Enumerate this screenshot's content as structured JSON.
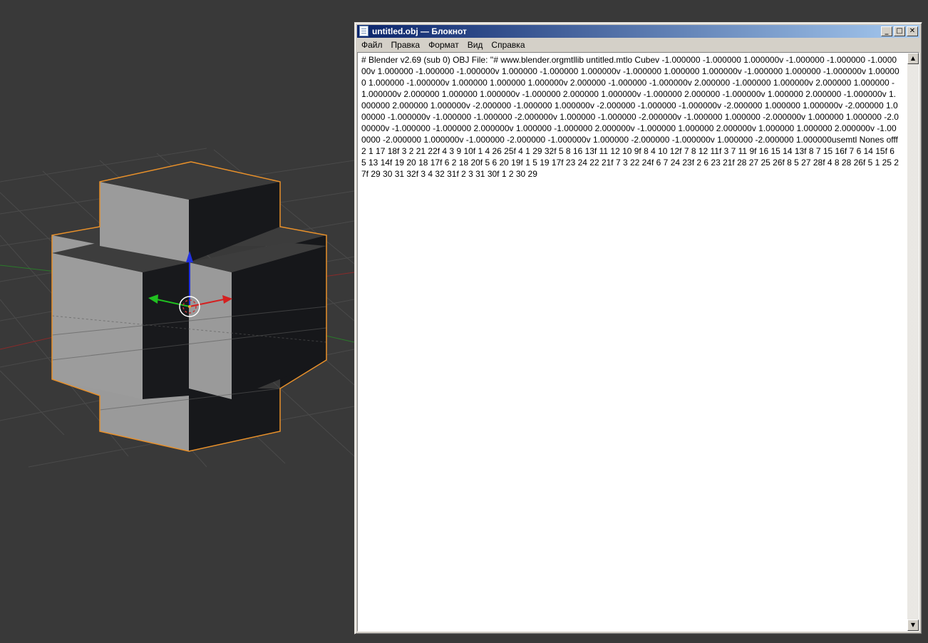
{
  "window": {
    "title": "untitled.obj — Блокнот",
    "buttons": {
      "minimize": "_",
      "maximize": "□",
      "close": "✕"
    }
  },
  "menu": [
    "Файл",
    "Правка",
    "Формат",
    "Вид",
    "Справка"
  ],
  "editor": {
    "content": "# Blender v2.69 (sub 0) OBJ File: ''# www.blender.orgmtllib untitled.mtlo Cubev -1.000000 -1.000000 1.000000v -1.000000 -1.000000 -1.000000v 1.000000 -1.000000 -1.000000v 1.000000 -1.000000 1.000000v -1.000000 1.000000 1.000000v -1.000000 1.000000 -1.000000v 1.000000 1.000000 -1.000000v 1.000000 1.000000 1.000000v 2.000000 -1.000000 -1.000000v 2.000000 -1.000000 1.000000v 2.000000 1.000000 -1.000000v 2.000000 1.000000 1.000000v -1.000000 2.000000 1.000000v -1.000000 2.000000 -1.000000v 1.000000 2.000000 -1.000000v 1.000000 2.000000 1.000000v -2.000000 -1.000000 1.000000v -2.000000 -1.000000 -1.000000v -2.000000 1.000000 1.000000v -2.000000 1.000000 -1.000000v -1.000000 -1.000000 -2.000000v 1.000000 -1.000000 -2.000000v -1.000000 1.000000 -2.000000v 1.000000 1.000000 -2.000000v -1.000000 -1.000000 2.000000v 1.000000 -1.000000 2.000000v -1.000000 1.000000 2.000000v 1.000000 1.000000 2.000000v -1.000000 -2.000000 1.000000v -1.000000 -2.000000 -1.000000v 1.000000 -2.000000 -1.000000v 1.000000 -2.000000 1.000000usemtl Nones offf 2 1 17 18f 3 2 21 22f 4 3 9 10f 1 4 26 25f 4 1 29 32f 5 8 16 13f 11 12 10 9f 8 4 10 12f 7 8 12 11f 3 7 11 9f 16 15 14 13f 8 7 15 16f 7 6 14 15f 6 5 13 14f 19 20 18 17f 6 2 18 20f 5 6 20 19f 1 5 19 17f 23 24 22 21f 7 3 22 24f 6 7 24 23f 2 6 23 21f 28 27 25 26f 8 5 27 28f 4 8 28 26f 5 1 25 27f 29 30 31 32f 3 4 32 31f 2 3 31 30f 1 2 30 29"
  },
  "scrollbar": {
    "up": "▲",
    "down": "▼"
  },
  "viewport": {
    "gizmo_colors": {
      "x": "#d42020",
      "y": "#20c020",
      "z": "#2030e0"
    },
    "selection_outline": "#e8902a",
    "background": "#393939"
  }
}
